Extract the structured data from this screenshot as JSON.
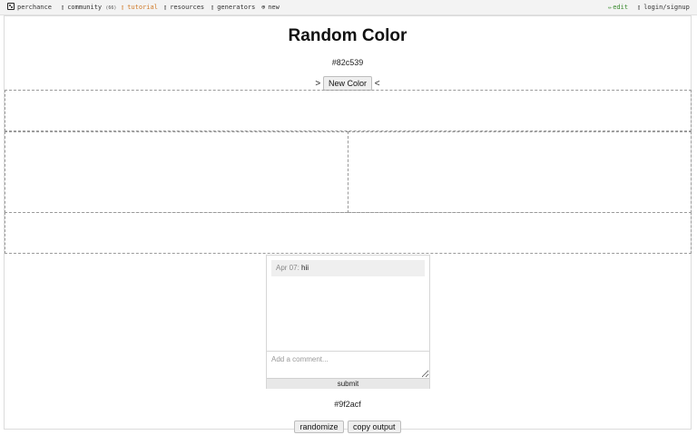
{
  "nav": {
    "perchance": "perchance",
    "community": "community",
    "community_badge": "(66)",
    "tutorial": "tutorial",
    "resources": "resources",
    "generators": "generators",
    "new": "new",
    "edit": "edit",
    "login": "login/signup"
  },
  "page": {
    "title": "Random Color",
    "color_value": "#82c539",
    "arrow_left": ">",
    "new_color_label": "New Color",
    "arrow_right": "<"
  },
  "comments": {
    "items": [
      {
        "date": "Apr 07:",
        "text": "hii"
      }
    ],
    "input_placeholder": "Add a comment...",
    "submit_label": "submit"
  },
  "output": {
    "color_value": "#9f2acf",
    "randomize_label": "randomize",
    "copy_label": "copy output"
  }
}
